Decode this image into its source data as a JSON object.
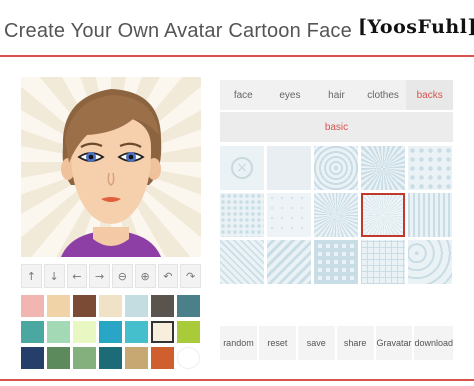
{
  "header": {
    "title": "Create Your Own Avatar Cartoon Face",
    "logo": "[YoosFuhl]"
  },
  "controls": [
    {
      "icon": "arrow-up-icon",
      "glyph": "↑"
    },
    {
      "icon": "arrow-down-icon",
      "glyph": "↓"
    },
    {
      "icon": "arrow-left-icon",
      "glyph": "←"
    },
    {
      "icon": "arrow-right-icon",
      "glyph": "→"
    },
    {
      "icon": "zoom-out-icon",
      "glyph": "⊖"
    },
    {
      "icon": "zoom-in-icon",
      "glyph": "⊕"
    },
    {
      "icon": "undo-icon",
      "glyph": "↶"
    },
    {
      "icon": "redo-icon",
      "glyph": "↷"
    }
  ],
  "palette": [
    "#f1b5b2",
    "#f1d3a8",
    "#7b4b36",
    "#efe2c7",
    "#c3dde0",
    "#59554e",
    "#4b7f8a",
    "#4aa8a1",
    "#a3d9b5",
    "#e9f7c3",
    "#29a6c6",
    "#46bfcc",
    "#f7eedd",
    "#a9cb3a",
    "#263f6a",
    "#5c8a5c",
    "#84b07d",
    "#1e6b78",
    "#c8a872",
    "#cf5f2e",
    "#ffffff"
  ],
  "selected_color": "#f7eedd",
  "tabs": [
    {
      "label": "face",
      "active": false
    },
    {
      "label": "eyes",
      "active": false
    },
    {
      "label": "hair",
      "active": false
    },
    {
      "label": "clothes",
      "active": false
    },
    {
      "label": "backs",
      "active": true
    }
  ],
  "subtab": {
    "label": "basic"
  },
  "backgrounds": [
    "none",
    "plain",
    "rings",
    "burst",
    "hearts",
    "dots",
    "plain-dots",
    "burst-rays",
    "rays",
    "stripes",
    "diag-lines",
    "diag-stripes",
    "squares",
    "grid-lines",
    "circles"
  ],
  "selected_background": 8,
  "actions": [
    {
      "label": "random"
    },
    {
      "label": "reset"
    },
    {
      "label": "save"
    },
    {
      "label": "share"
    },
    {
      "label": "Gravatar"
    },
    {
      "label": "download"
    }
  ]
}
